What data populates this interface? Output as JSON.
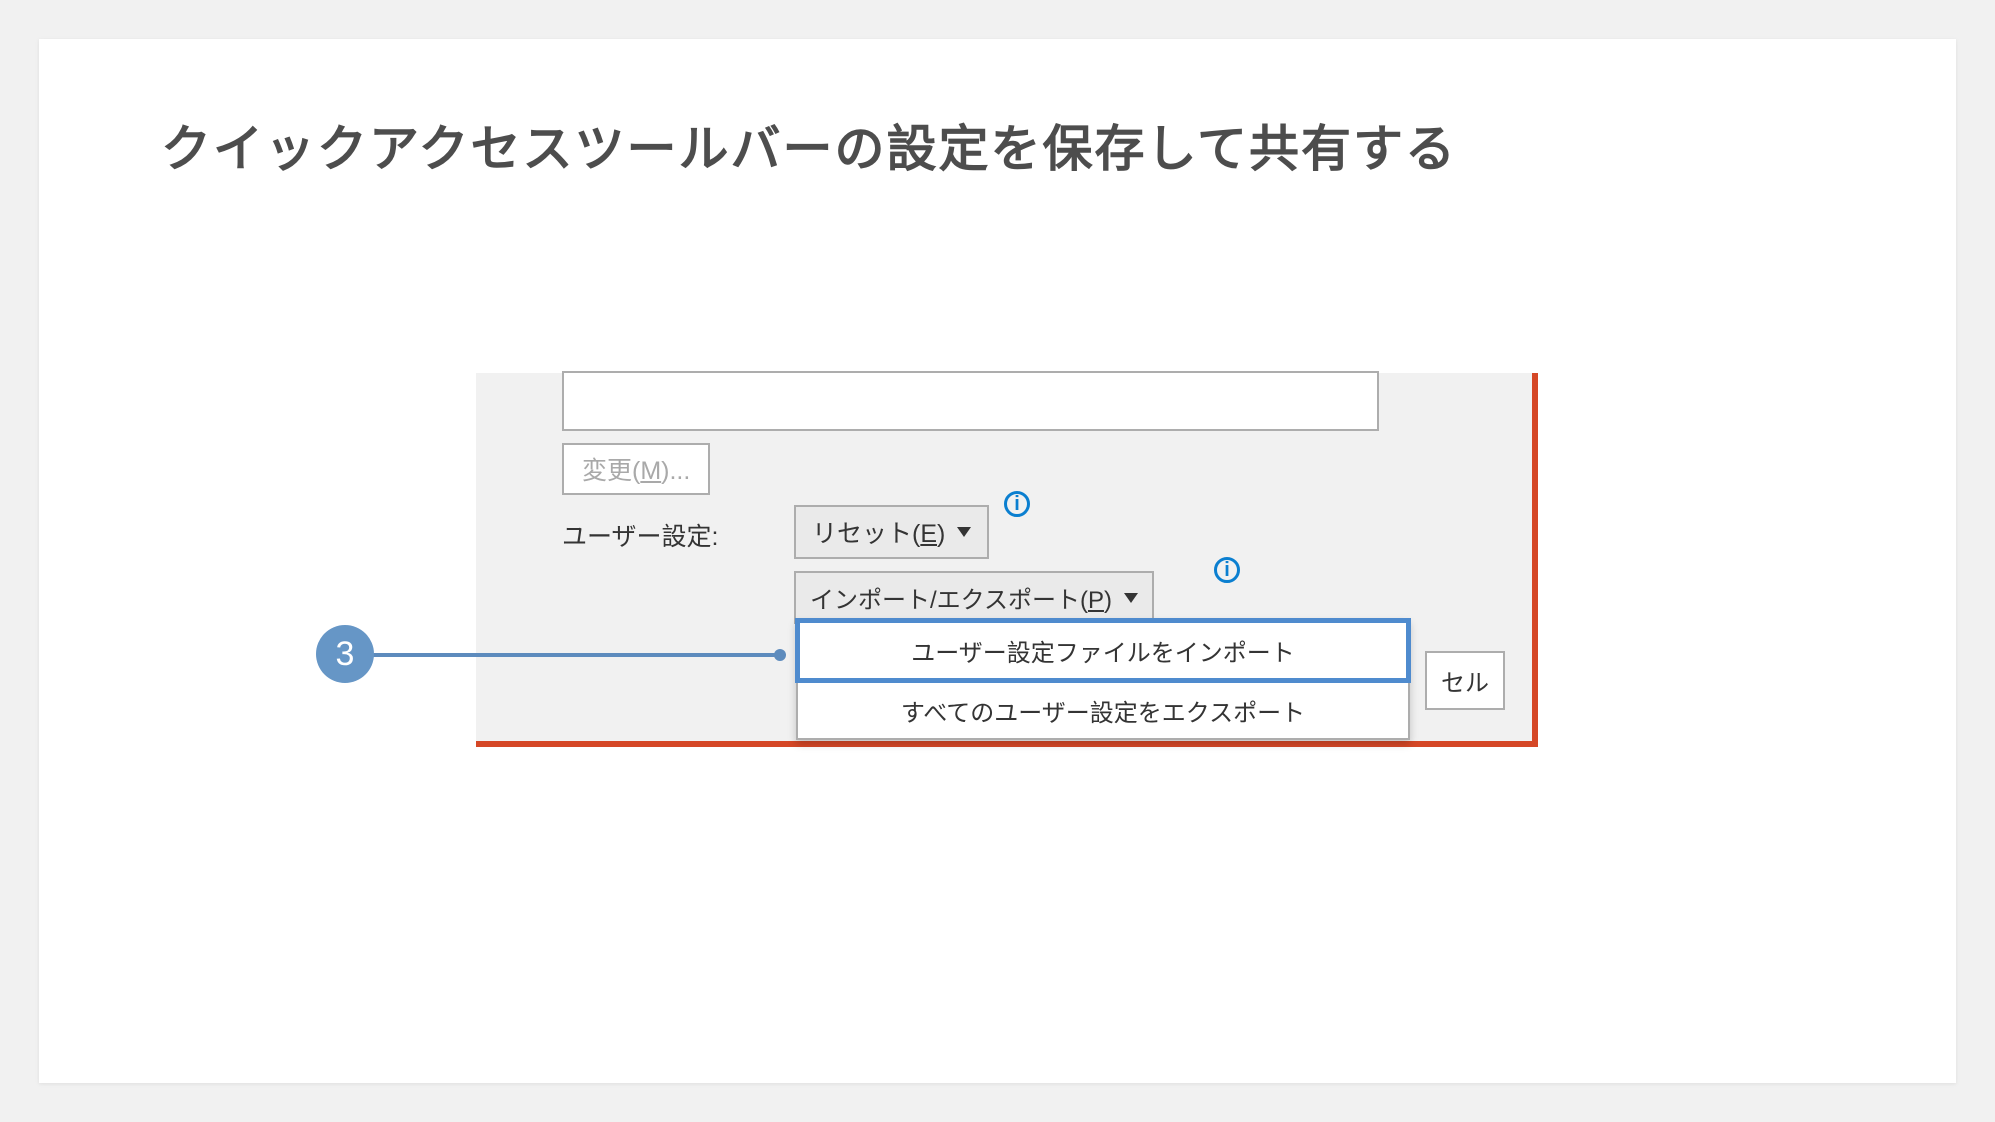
{
  "title": "クイックアクセスツールバーの設定を保存して共有する",
  "change": {
    "before": "変更(",
    "u": "M",
    "after": ")..."
  },
  "user_settings_label": "ユーザー設定:",
  "reset": {
    "before": "リセット(",
    "u": "E",
    "after": ")"
  },
  "impexp": {
    "before": "インポート/エクスポート(",
    "u": "P",
    "after": ")"
  },
  "dropdown": {
    "import_item": "ユーザー設定ファイルをインポート",
    "export_item": "すべてのユーザー設定をエクスポート"
  },
  "cancel": "セル",
  "badge": "3"
}
